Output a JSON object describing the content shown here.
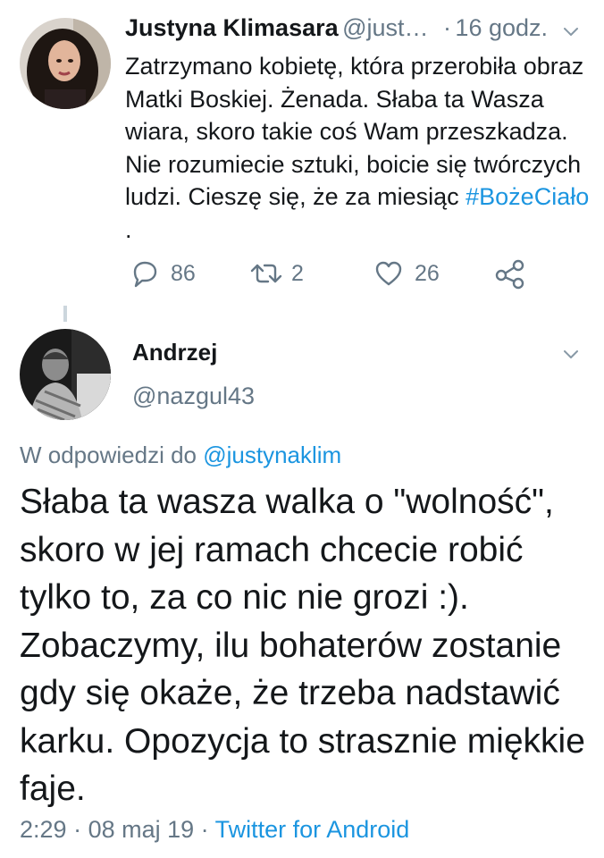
{
  "tweet1": {
    "name": "Justyna Klimasara",
    "handle": "@just…",
    "separator": "·",
    "time": "16 godz.",
    "text_before": "Zatrzymano kobietę, która przerobiła obraz Matki Boskiej. Żenada. Słaba ta Wasza wiara, skoro takie coś Wam przeszkadza. Nie rozumiecie sztuki, boicie się twórczych ludzi. Cieszę się, że za miesiąc ",
    "hashtag": "#BożeCiało",
    "text_after": " .",
    "actions": {
      "reply_count": "86",
      "retweet_count": "2",
      "like_count": "26"
    }
  },
  "tweet2": {
    "name": "Andrzej",
    "handle": "@nazgul43",
    "reply_prefix": "W odpowiedzi do ",
    "reply_handle": "@justynaklim",
    "text": "Słaba ta wasza walka o \"wolność\", skoro w jej ramach chcecie robić tylko to, za co nic nie grozi :). Zobaczymy, ilu bohaterów zostanie gdy się okaże, że trzeba nadstawić karku. Opozycja to strasznie miękkie faje.",
    "time": "2:29",
    "separator1": " · ",
    "date": "08 maj 19",
    "separator2": " · ",
    "source": "Twitter for Android"
  },
  "colors": {
    "text": "#14171a",
    "secondary": "#657786",
    "link": "#1b95e0"
  },
  "icons": [
    "reply-icon",
    "retweet-icon",
    "like-icon",
    "share-icon",
    "chevron-down-icon"
  ]
}
